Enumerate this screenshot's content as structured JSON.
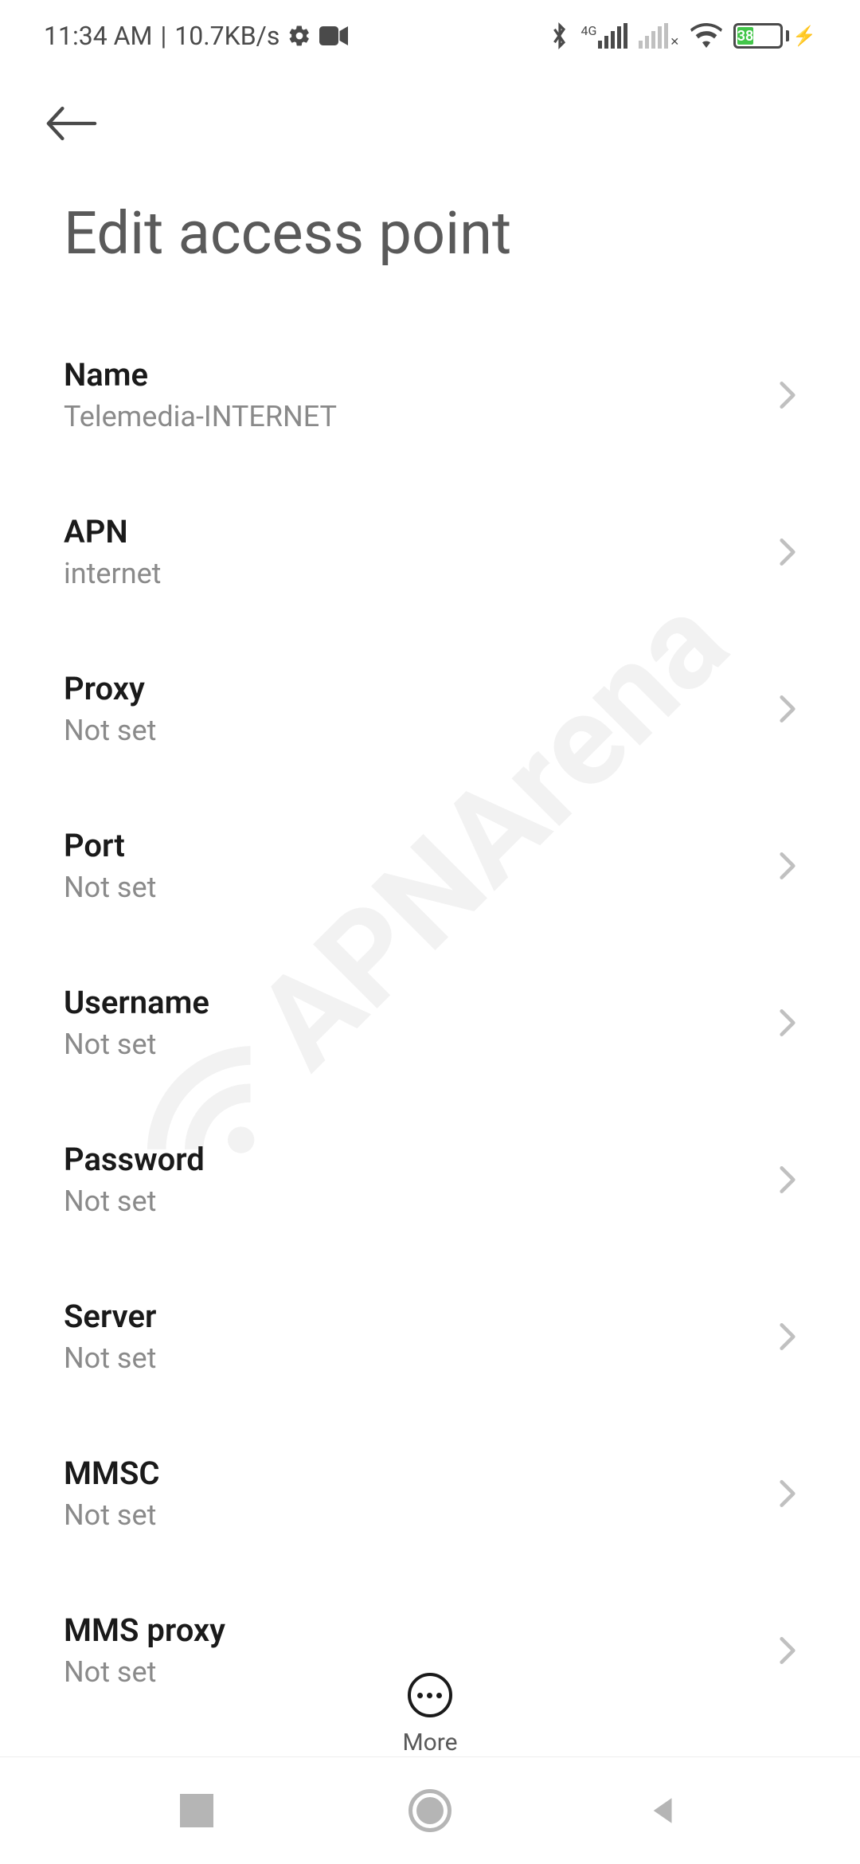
{
  "statusbar": {
    "time": "11:34 AM",
    "speed": "10.7KB/s",
    "network_label": "4G",
    "battery_percent": "38"
  },
  "page": {
    "title": "Edit access point"
  },
  "fields": [
    {
      "label": "Name",
      "value": "Telemedia-INTERNET"
    },
    {
      "label": "APN",
      "value": "internet"
    },
    {
      "label": "Proxy",
      "value": "Not set"
    },
    {
      "label": "Port",
      "value": "Not set"
    },
    {
      "label": "Username",
      "value": "Not set"
    },
    {
      "label": "Password",
      "value": "Not set"
    },
    {
      "label": "Server",
      "value": "Not set"
    },
    {
      "label": "MMSC",
      "value": "Not set"
    },
    {
      "label": "MMS proxy",
      "value": "Not set"
    }
  ],
  "bottom_action": {
    "more_label": "More"
  },
  "watermark": {
    "text": "APNArena"
  }
}
